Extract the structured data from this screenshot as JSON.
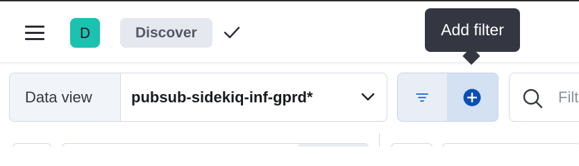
{
  "header": {
    "menu_icon": "hamburger-icon",
    "avatar_initial": "D",
    "breadcrumb": "Discover",
    "check_icon": "check-icon"
  },
  "tooltip": {
    "text": "Add filter"
  },
  "query_bar": {
    "data_view_label": "Data view",
    "data_view_value": "pubsub-sidekiq-inf-gprd*",
    "filter_icon": "filter-lines-icon",
    "add_filter_icon": "plus-circle-icon",
    "search_icon": "search-icon",
    "search_placeholder": "Filt"
  },
  "colors": {
    "avatar": "#1cc2b0",
    "breadcrumb_bg": "#e5e8ee",
    "tooltip_bg": "#343741",
    "accent": "#0b64dd"
  }
}
